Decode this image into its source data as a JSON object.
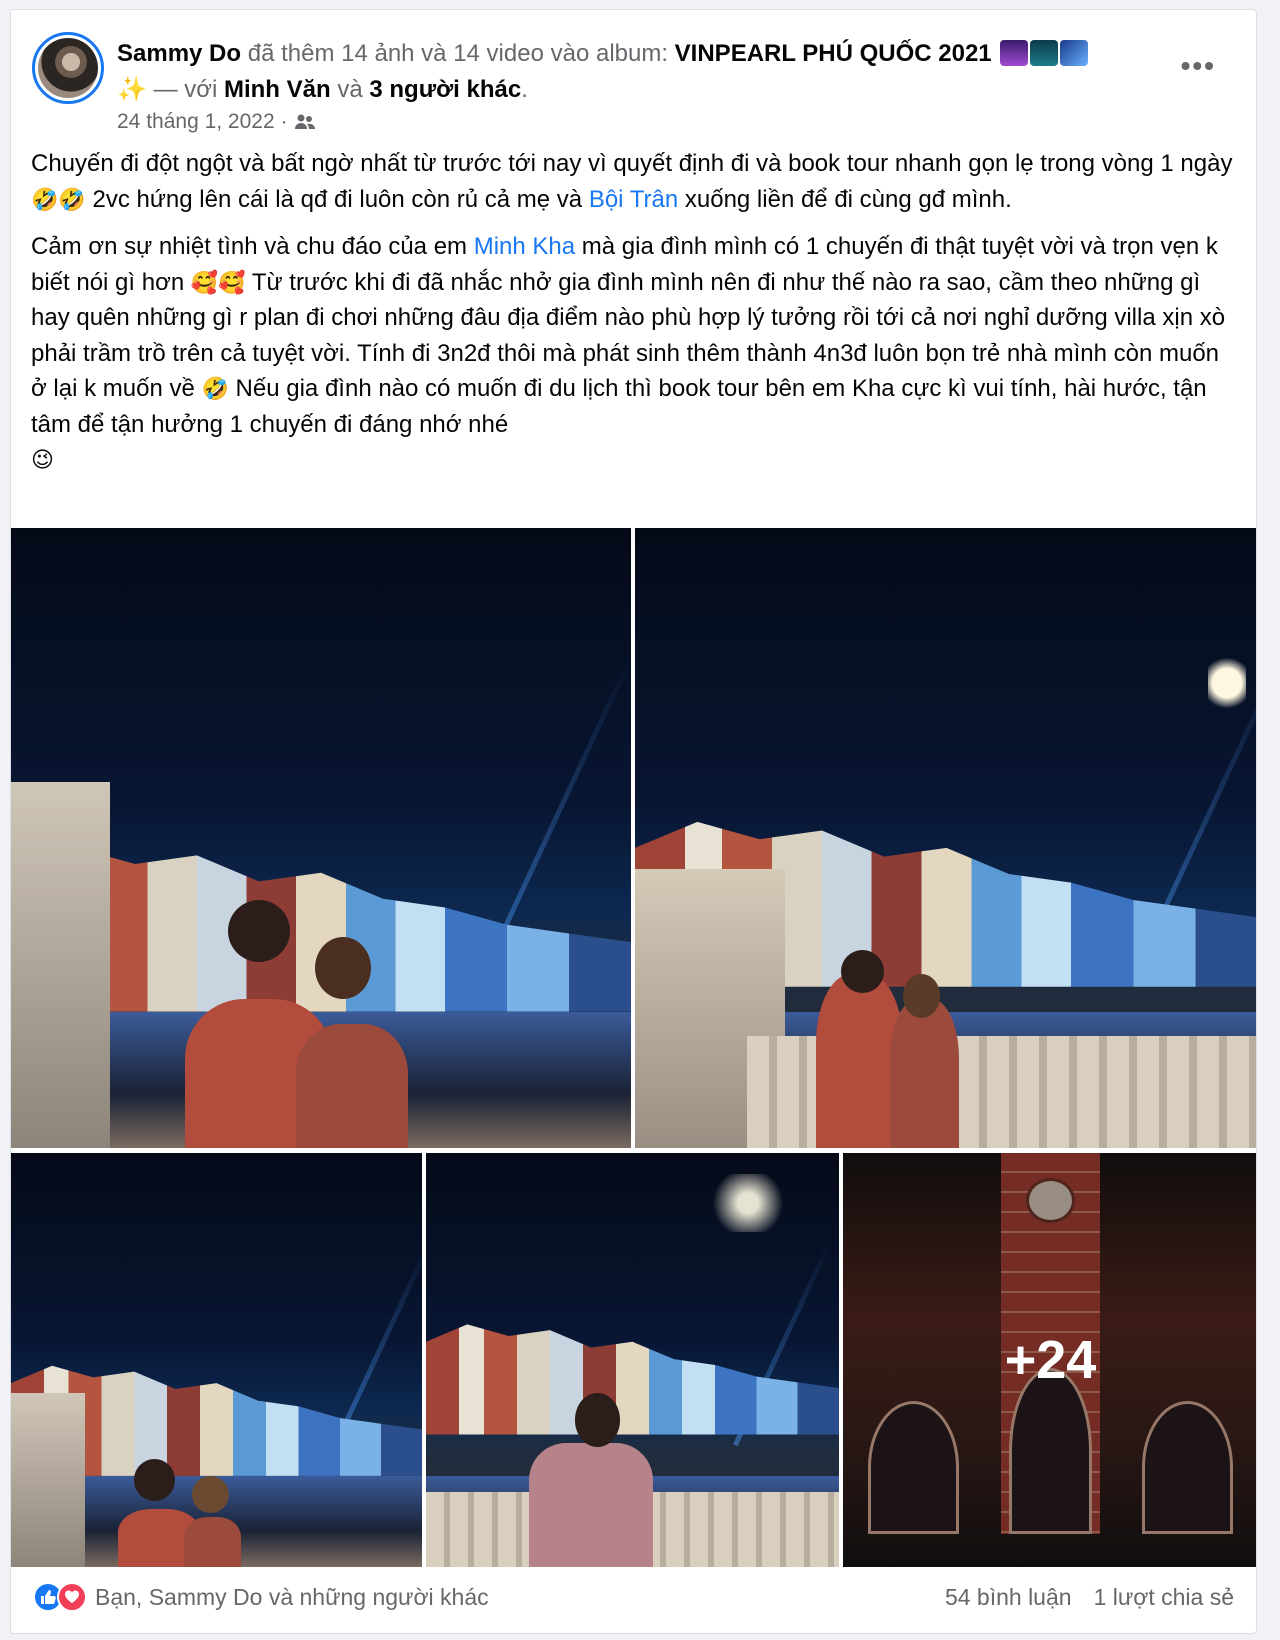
{
  "post": {
    "author": "Sammy Do",
    "action": "đã thêm 14 ảnh và 14 video vào album:",
    "album": "VINPEARL PHÚ QUỐC 2021",
    "with_text": "— với",
    "tagged_person": "Minh Văn",
    "and_text": "và",
    "others": "3 người khác",
    "period": ".",
    "date": "24 tháng 1, 2022",
    "separator": "·",
    "audience_icon": "friends-icon",
    "more_icon": "more-options-icon",
    "paragraph1": {
      "part1": "Chuyến đi đột ngột và bất ngờ nhất từ trước tới nay vì quyết định đi và book tour nhanh gọn lẹ trong vòng 1 ngày",
      "emoji1": "🤣🤣",
      "part2": " 2vc hứng lên cái là qđ đi luôn còn rủ cả mẹ và ",
      "mention": "Bội Trân",
      "part3": " xuống liền để đi cùng gđ mình."
    },
    "paragraph2": {
      "part1": "Cảm ơn sự nhiệt tình và chu đáo của em ",
      "mention": "Minh Kha",
      "part2": " mà gia đình mình có 1 chuyến đi thật tuyệt vời và trọn vẹn k biết nói gì hơn ",
      "emoji1": "🥰🥰",
      "part3": " Từ trước khi đi đã nhắc nhở gia đình mình nên đi như thế nào ra sao, cầm theo những gì hay quên những gì r plan đi chơi những đâu địa điểm nào phù hợp lý tưởng rồi tới cả nơi nghỉ dưỡng villa xịn xò phải trầm trồ trên cả tuyệt vời. Tính đi 3n2đ thôi mà phát sinh thêm thành 4n3đ luôn bọn trẻ nhà mình còn muốn ở lại k muốn về ",
      "emoji2": "🤣",
      "part4": " Nếu gia đình nào có muốn đi du lịch thì book tour bên em Kha cực kì vui tính, hài hước, tận tâm để tận hưởng 1 chuyến đi đáng nhớ nhé ",
      "emoji3": "😉"
    },
    "more_count": "+24"
  },
  "footer": {
    "reactions_text": "Bạn, Sammy Do và những người khác",
    "comments": "54 bình luận",
    "shares": "1 lượt chia sẻ",
    "like_icon": "like-icon",
    "love_icon": "love-icon"
  },
  "colors": {
    "link": "#1877f2",
    "secondary_text": "#65676b",
    "like": "#1877f2",
    "love": "#f33e58"
  }
}
